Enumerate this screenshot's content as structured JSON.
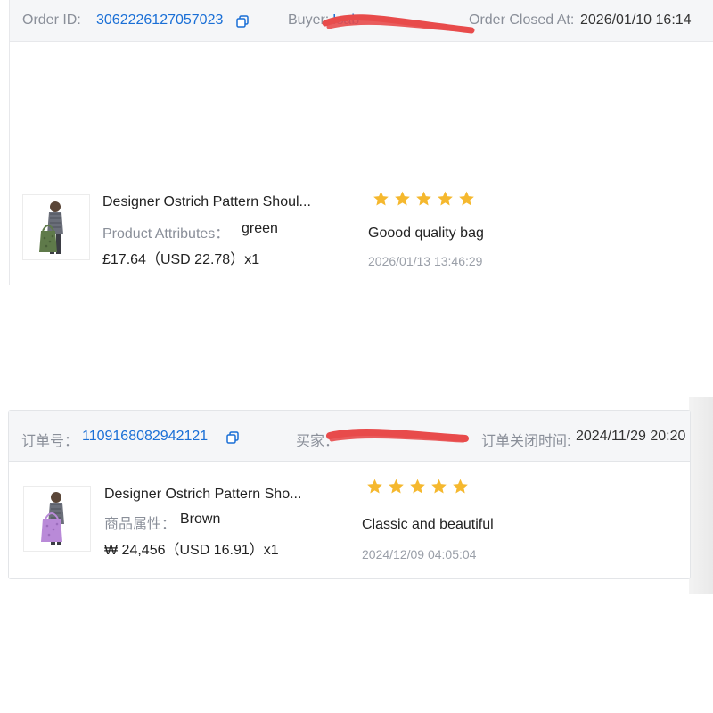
{
  "colors": {
    "link": "#1a6fd6",
    "star": "#f5b82e",
    "redaction": "#e84b4b",
    "header_bg": "#f5f6f8"
  },
  "order1": {
    "order_id_label": "Order ID:",
    "order_id": "3062226127057023",
    "buyer_label": "Buyer:",
    "buyer_name_visible": "Isab",
    "closed_label": "Order Closed At:",
    "closed_at": "2026/01/10 16:14",
    "item": {
      "title": "Designer Ostrich Pattern Shoul...",
      "attr_label": "Product Attributes：",
      "attr_value": "green",
      "price": "£17.64（USD  22.78）x1",
      "thumbnail_icon": "bag-thumbnail-green"
    },
    "review": {
      "rating": 5,
      "text": "Goood quality bag",
      "date": "2026/01/13 13:46:29"
    }
  },
  "order2": {
    "order_id_label": "订单号：",
    "order_id": "1109168082942121",
    "buyer_label": "买家：",
    "closed_label": "订单关闭时间:",
    "closed_at": "2024/11/29 20:20",
    "item": {
      "title": "Designer Ostrich Pattern Sho...",
      "attr_label": "商品属性：",
      "attr_value": "Brown",
      "price": "₩ 24,456（USD  16.91）x1",
      "thumbnail_icon": "bag-thumbnail-purple"
    },
    "review": {
      "rating": 5,
      "text": "Classic and beautiful",
      "date": "2024/12/09 04:05:04"
    }
  }
}
